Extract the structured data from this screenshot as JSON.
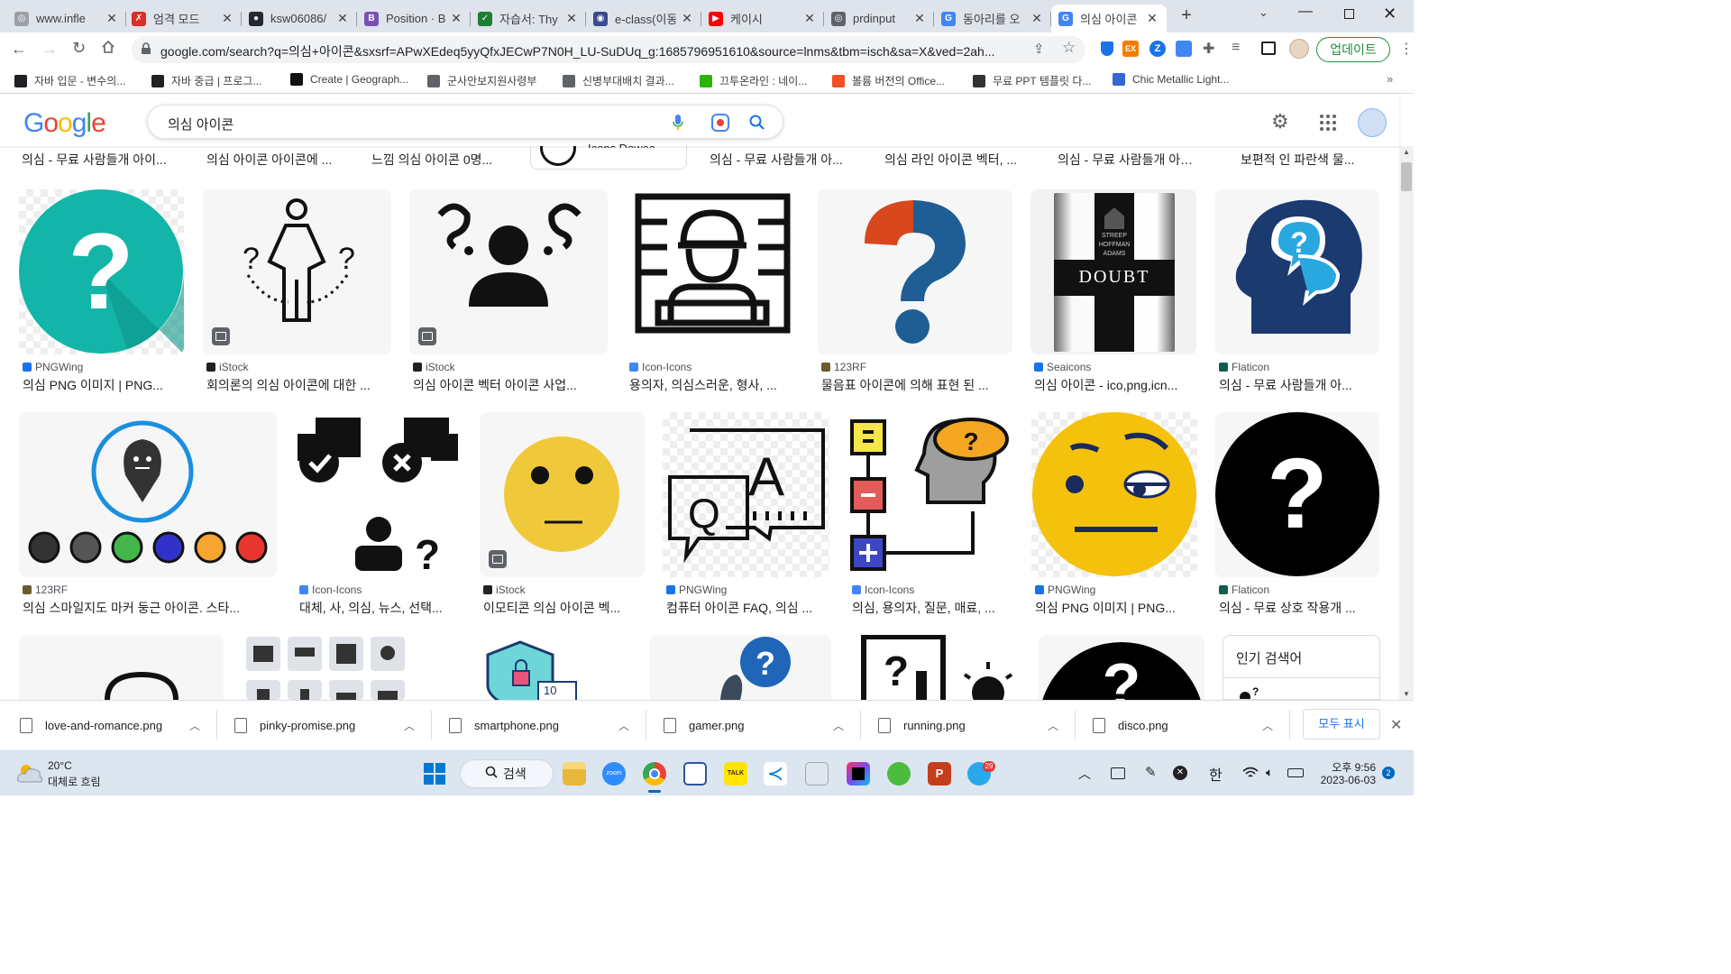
{
  "tabs": [
    {
      "title": "www.infle",
      "color": "#9aa0a6",
      "glyph": "◎"
    },
    {
      "title": "엄격 모드",
      "color": "#d93025",
      "glyph": "✗"
    },
    {
      "title": "ksw06086/",
      "color": "#24292f",
      "glyph": "●"
    },
    {
      "title": "Position · B",
      "color": "#7952b3",
      "glyph": "B"
    },
    {
      "title": "자습서: Thy",
      "color": "#1e7e34",
      "glyph": "✓"
    },
    {
      "title": "e-class(이동",
      "color": "#3b4a8c",
      "glyph": "◉"
    },
    {
      "title": "케이시",
      "color": "#ff0000",
      "glyph": "▶"
    },
    {
      "title": "prdinput",
      "color": "#5f6368",
      "glyph": "◎"
    },
    {
      "title": "동아리를 오",
      "color": "#4285f4",
      "glyph": "G"
    },
    {
      "title": "의심 아이콘",
      "color": "#4285f4",
      "glyph": "G"
    }
  ],
  "omnibox": {
    "url": "google.com/search?q=의심+아이콘&sxsrf=APwXEdeq5yyQfxJECwP7N0H_LU-SuDUq_g:1685796951610&source=lnms&tbm=isch&sa=X&ved=2ah..."
  },
  "update_button": "업데이트",
  "bookmarks": [
    {
      "label": "자바 입문 - 변수의...",
      "color": "#202124"
    },
    {
      "label": "자바 중급 | 프로그...",
      "color": "#202124"
    },
    {
      "label": "Create | Geograph...",
      "color": "#111111"
    },
    {
      "label": "군사안보지원사령부",
      "color": "#5f6368"
    },
    {
      "label": "신병부대배치 결과...",
      "color": "#5f6368"
    },
    {
      "label": "끄투온라인 : 네이...",
      "color": "#2db400"
    },
    {
      "label": "볼륨 버전의 Office...",
      "color": "#f25022"
    },
    {
      "label": "무료 PPT 템플릿 다...",
      "color": "#333333"
    },
    {
      "label": "Chic Metallic Light...",
      "color": "#3367d6"
    }
  ],
  "search": {
    "query": "의심 아이콘"
  },
  "top_row_titles": [
    "의심 - 무료 사람들개 아이...",
    "의심 아이콘 아이콘에 ...",
    "느낌 의심 아이콘 0명...",
    "Icons Dawaa",
    "의심 - 무료 사람들개 아...",
    "의심 라인 아이콘 벡터, ...",
    "의심 - 무료 사람들개 아이...",
    "보편적 인 파란색 물..."
  ],
  "row1": [
    {
      "source": "PNGWing",
      "title": "의심 PNG 이미지 | PNG...",
      "src_color": "#1a73e8"
    },
    {
      "source": "iStock",
      "title": "회의론의 의심 아이콘에 대한 ...",
      "src_color": "#202124"
    },
    {
      "source": "iStock",
      "title": "의심 아이콘 벡터 아이콘 사업...",
      "src_color": "#202124"
    },
    {
      "source": "Icon-Icons",
      "title": "용의자, 의심스러운, 형사, ...",
      "src_color": "#4285f4"
    },
    {
      "source": "123RF",
      "title": "물음표 아이콘에 의해 표현 된 ...",
      "src_color": "#6b5b2e"
    },
    {
      "source": "Seaicons",
      "title": "의심 아이콘 - ico,png,icn...",
      "src_color": "#1a73e8"
    },
    {
      "source": "Flaticon",
      "title": "의심 - 무료 사람들개 아...",
      "src_color": "#0e5f4e"
    }
  ],
  "row2": [
    {
      "source": "123RF",
      "title": "의심 스마일지도 마커 둥근 아이콘. 스타...",
      "src_color": "#6b5b2e"
    },
    {
      "source": "Icon-Icons",
      "title": "대체, 사, 의심, 뉴스, 선택...",
      "src_color": "#4285f4"
    },
    {
      "source": "iStock",
      "title": "이모티콘 의심 아이콘 벡...",
      "src_color": "#202124"
    },
    {
      "source": "PNGWing",
      "title": "컴퓨터 아이콘 FAQ, 의심 ...",
      "src_color": "#1a73e8"
    },
    {
      "source": "Icon-Icons",
      "title": "의심, 용의자, 질문, 매료, ...",
      "src_color": "#4285f4"
    },
    {
      "source": "PNGWing",
      "title": "의심 PNG 이미지 | PNG...",
      "src_color": "#1a73e8"
    },
    {
      "source": "Flaticon",
      "title": "의심 - 무료 상호 작용개 ...",
      "src_color": "#0e5f4e"
    }
  ],
  "doubt_poster": {
    "actors": [
      "STREEP",
      "HOFFMAN",
      "ADAMS"
    ],
    "title": "DOUBT"
  },
  "qa_letters": {
    "q": "Q",
    "a": "A"
  },
  "popular_label": "인기 검색어",
  "downloads": [
    "love-and-romance.png",
    "pinky-promise.png",
    "smartphone.png",
    "gamer.png",
    "running.png",
    "disco.png"
  ],
  "show_all": "모두 표시",
  "taskbar": {
    "weather_temp": "20°C",
    "weather_desc": "대체로 흐림",
    "search_label": "검색",
    "time": "오후 9:56",
    "date": "2023-06-03",
    "notif_count": "2",
    "telegram_badge": "29",
    "ime": "한"
  },
  "colors": {
    "accent": "#1a73e8",
    "teal": "#12b5a8",
    "yellow": "#f4c20d",
    "navy": "#1b3a70"
  }
}
